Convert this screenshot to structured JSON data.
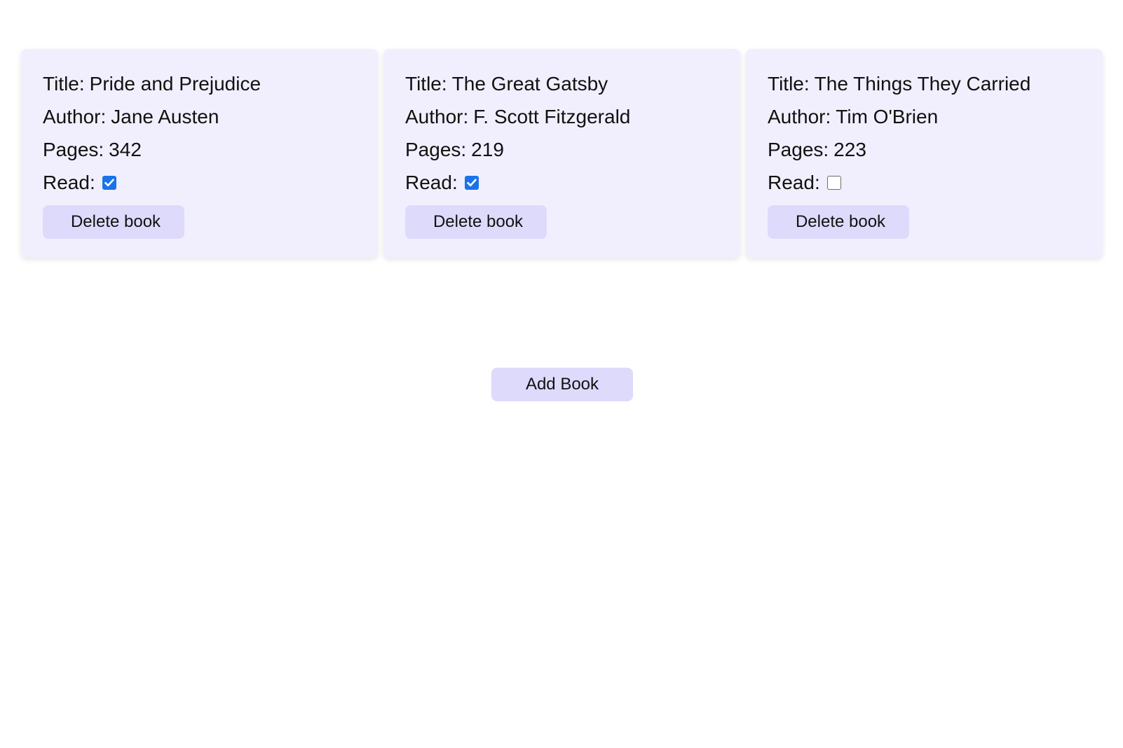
{
  "books": [
    {
      "title_label": "Title:",
      "title": "Pride and Prejudice",
      "author_label": "Author:",
      "author": "Jane Austen",
      "pages_label": "Pages:",
      "pages": "342",
      "read_label": "Read:",
      "read": true,
      "delete_label": "Delete book"
    },
    {
      "title_label": "Title:",
      "title": "The Great Gatsby",
      "author_label": "Author:",
      "author": "F. Scott Fitzgerald",
      "pages_label": "Pages:",
      "pages": "219",
      "read_label": "Read:",
      "read": true,
      "delete_label": "Delete book"
    },
    {
      "title_label": "Title:",
      "title": "The Things They Carried",
      "author_label": "Author:",
      "author": "Tim O'Brien",
      "pages_label": "Pages:",
      "pages": "223",
      "read_label": "Read:",
      "read": false,
      "delete_label": "Delete book"
    }
  ],
  "add_book_label": "Add Book",
  "colors": {
    "card_background": "#f1effd",
    "button_background": "#dedafc",
    "checkbox_checked": "#1a73e8"
  }
}
